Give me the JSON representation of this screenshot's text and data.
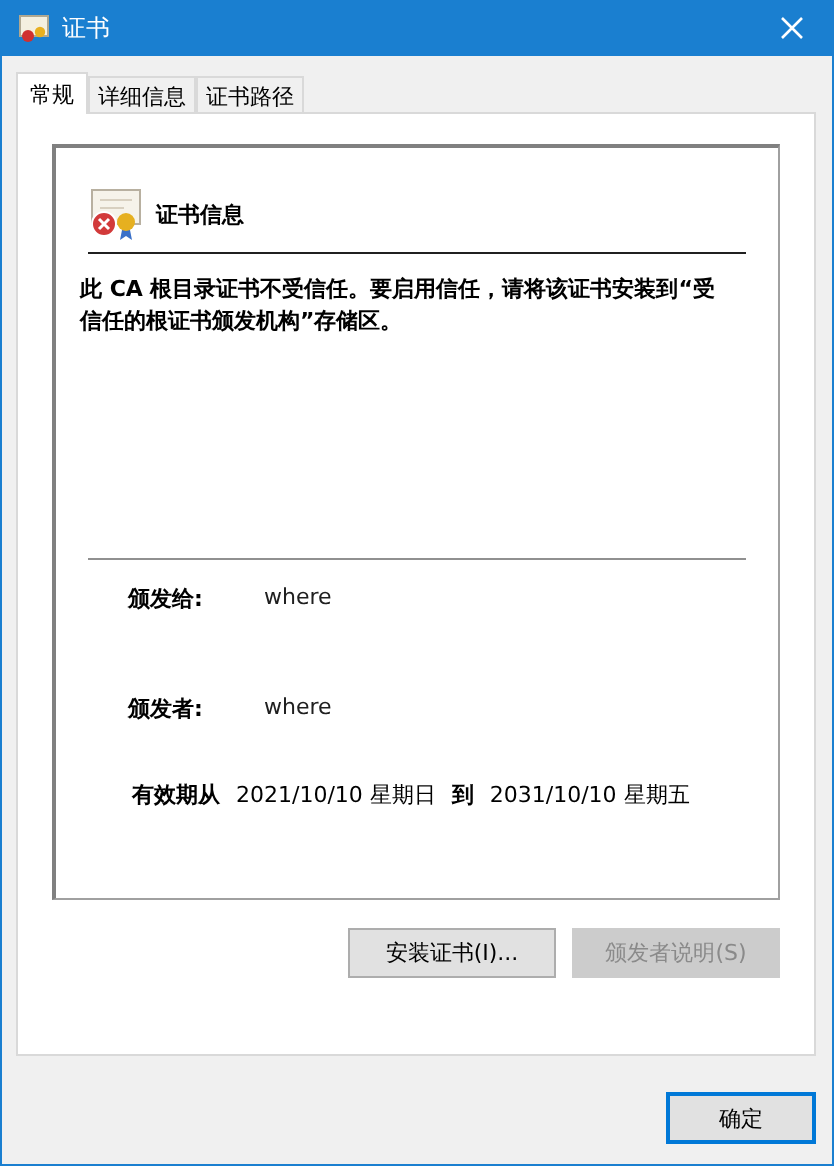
{
  "window": {
    "title": "证书"
  },
  "tabs": [
    {
      "label": "常规",
      "selected": true
    },
    {
      "label": "详细信息",
      "selected": false
    },
    {
      "label": "证书路径",
      "selected": false
    }
  ],
  "certificate_info": {
    "heading": "证书信息",
    "message": "此 CA 根目录证书不受信任。要启用信任，请将该证书安装到“受信任的根证书颁发机构”存储区。",
    "issued_to": {
      "label": "颁发给:",
      "value": "where"
    },
    "issued_by": {
      "label": "颁发者:",
      "value": "where"
    },
    "validity": {
      "label": "有效期从",
      "from": "2021/10/10 星期日",
      "to_label": "到",
      "to": "2031/10/10 星期五"
    }
  },
  "buttons": [
    {
      "label": "安装证书(I)...",
      "disabled": false
    },
    {
      "label": "颁发者说明(S)",
      "disabled": true
    }
  ],
  "ok_button": {
    "label": "确定"
  }
}
